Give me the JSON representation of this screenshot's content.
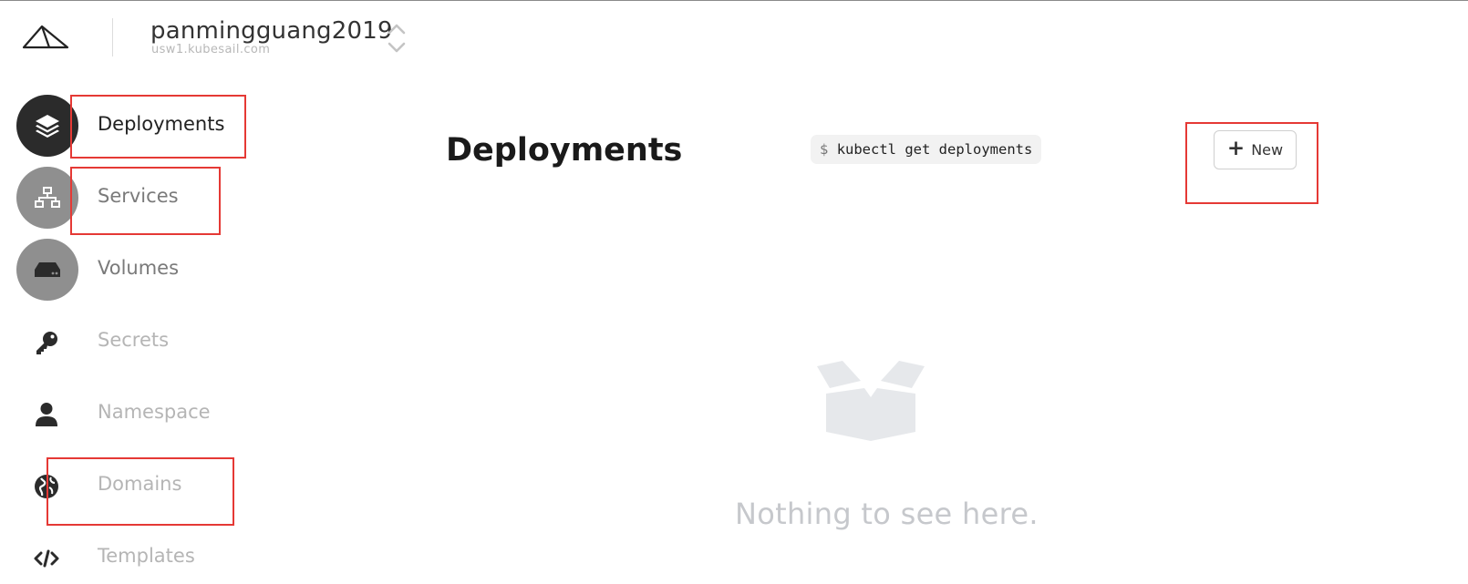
{
  "header": {
    "cluster_name": "panmingguang2019",
    "cluster_host": "usw1.kubesail.com"
  },
  "sidebar": {
    "items": [
      {
        "label": "Deployments",
        "icon": "layers-icon"
      },
      {
        "label": "Services",
        "icon": "network-icon"
      },
      {
        "label": "Volumes",
        "icon": "hard-drive-icon"
      },
      {
        "label": "Secrets",
        "icon": "key-icon"
      },
      {
        "label": "Namespace",
        "icon": "user-icon"
      },
      {
        "label": "Domains",
        "icon": "globe-icon"
      },
      {
        "label": "Templates",
        "icon": "code-icon"
      }
    ]
  },
  "main": {
    "title": "Deployments",
    "command_prompt": "$",
    "command": "kubectl get deployments",
    "new_button_label": "New",
    "empty_message": "Nothing to see here."
  },
  "colors": {
    "annotation": "#e53935",
    "active_circle": "#2b2b2b",
    "inactive_circle": "#8f8f8f",
    "empty_state": "#c6c8cc"
  }
}
